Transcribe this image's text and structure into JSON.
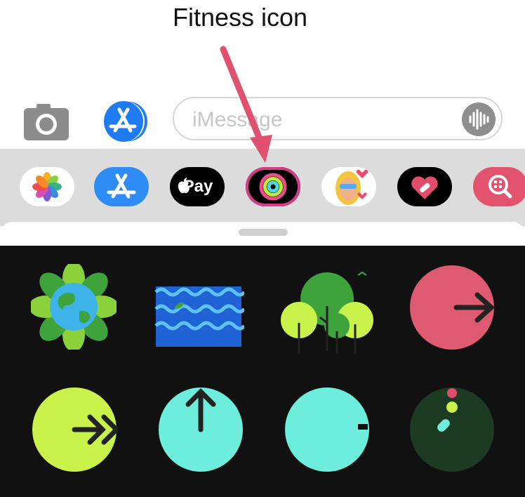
{
  "annotation": {
    "label": "Fitness icon",
    "arrow_color": "#e0516f"
  },
  "compose": {
    "placeholder": "iMessage",
    "camera_icon": "camera-icon",
    "appstore_icon": "app-store-icon",
    "audio_icon": "audio-waveform-icon"
  },
  "app_drawer": {
    "apps": [
      {
        "name": "Photos",
        "icon": "photos-icon"
      },
      {
        "name": "App Store",
        "icon": "app-store-icon"
      },
      {
        "name": "Apple Pay",
        "icon": "apple-pay-icon",
        "label": "Pay"
      },
      {
        "name": "Fitness",
        "icon": "activity-rings-icon"
      },
      {
        "name": "Memoji",
        "icon": "memoji-icon"
      },
      {
        "name": "Digital Touch",
        "icon": "heart-icon"
      },
      {
        "name": "Search",
        "icon": "search-icon"
      }
    ]
  },
  "stickers": [
    {
      "name": "earth-day-award",
      "icon": "earth-flower-icon"
    },
    {
      "name": "ocean-award",
      "icon": "waves-icon"
    },
    {
      "name": "trees-award",
      "icon": "trees-icon"
    },
    {
      "name": "move-ring-sticker",
      "icon": "arrow-right-icon"
    },
    {
      "name": "exercise-ring-sticker",
      "icon": "double-arrow-right-icon"
    },
    {
      "name": "stand-ring-sticker",
      "icon": "arrow-up-icon"
    },
    {
      "name": "stand-ring-partial-sticker",
      "icon": "ring-icon"
    },
    {
      "name": "rings-dots-sticker",
      "icon": "dots-icon"
    }
  ],
  "colors": {
    "move": "#dd5a70",
    "exercise": "#c9f24a",
    "stand": "#6deedd",
    "background": "#111111"
  }
}
